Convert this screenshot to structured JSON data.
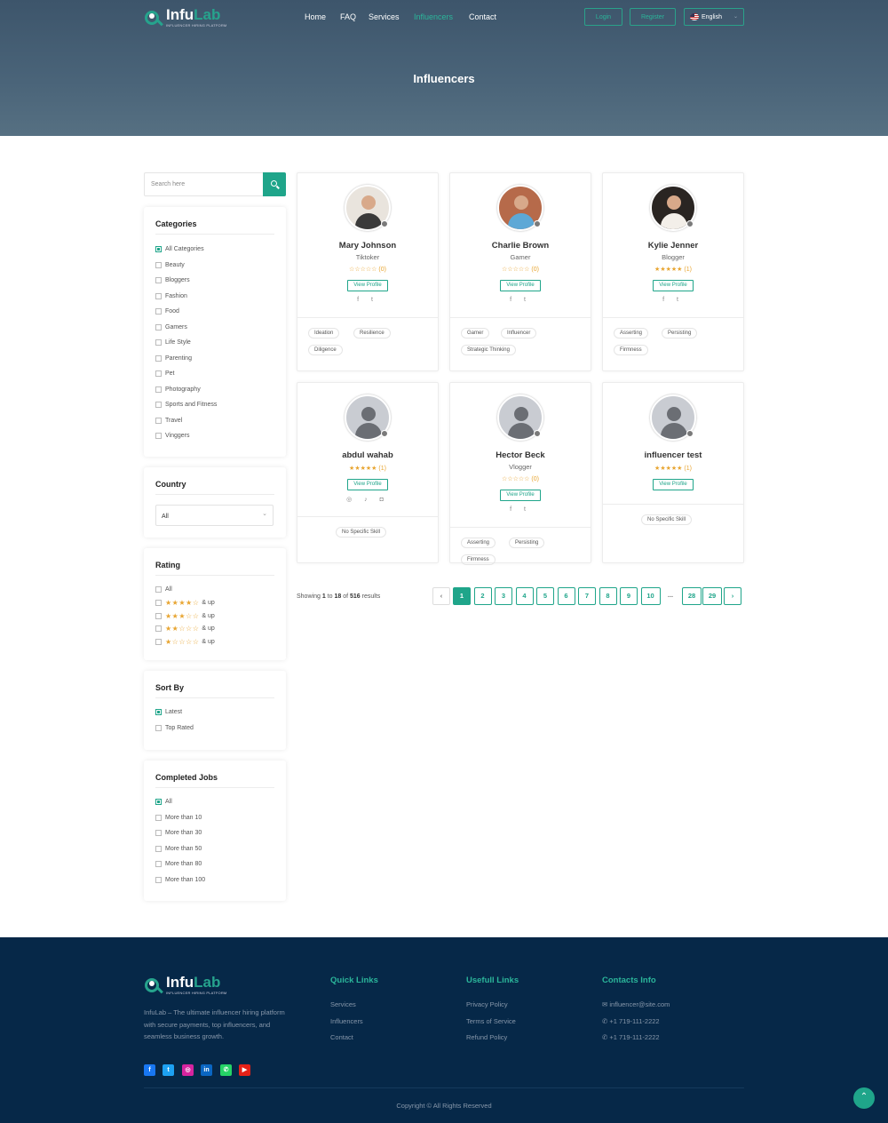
{
  "brand": {
    "name_a": "Infu",
    "name_b": "Lab",
    "tagline": "INFLUENCER HIRING PLATFORM"
  },
  "nav": [
    {
      "label": "Home"
    },
    {
      "label": "FAQ"
    },
    {
      "label": "Services"
    },
    {
      "label": "Influencers"
    },
    {
      "label": "Contact"
    }
  ],
  "header_buttons": {
    "login": "Login",
    "register": "Register",
    "language": "English"
  },
  "page_title": "Influencers",
  "search": {
    "placeholder": "Search here"
  },
  "categories": {
    "title": "Categories",
    "items": [
      "All Categories",
      "Beauty",
      "Bloggers",
      "Fashion",
      "Food",
      "Gamers",
      "Life Style",
      "Parenting",
      "Pet",
      "Photography",
      "Sports and Fitness",
      "Travel",
      "Vinggers"
    ],
    "checked": "All Categories"
  },
  "country": {
    "title": "Country",
    "selected": "All"
  },
  "rating": {
    "title": "Rating",
    "all": "All",
    "up_label": "& up",
    "levels": [
      4,
      3,
      2,
      1
    ]
  },
  "sort": {
    "title": "Sort By",
    "items": [
      "Latest",
      "Top Rated"
    ],
    "checked": "Latest"
  },
  "jobs": {
    "title": "Completed Jobs",
    "items": [
      "All",
      "More than 10",
      "More than 30",
      "More than 50",
      "More than 80",
      "More than 100"
    ],
    "checked": "All"
  },
  "view_profile": "View Profile",
  "influencers": [
    {
      "name": "Mary Johnson",
      "role": "Tiktoker",
      "stars": "☆☆☆☆☆",
      "count": "(0)",
      "socials": "f t",
      "tags": [
        "Ideation",
        "Resilience",
        "Diligence"
      ]
    },
    {
      "name": "Charlie Brown",
      "role": "Gamer",
      "stars": "☆☆☆☆☆",
      "count": "(0)",
      "socials": "f t",
      "tags": [
        "Gamer",
        "Influencer",
        "Strategic Thinking"
      ]
    },
    {
      "name": "Kylie Jenner",
      "role": "Blogger",
      "stars": "★★★★★",
      "count": "(1)",
      "socials": "f t",
      "tags": [
        "Asserting",
        "Persisting",
        "Firmness"
      ]
    },
    {
      "name": "abdul wahab",
      "role": "",
      "stars": "★★★★★",
      "count": "(1)",
      "socials": "◎ ♪ ◘",
      "tags": [
        "No Specific Skill"
      ]
    },
    {
      "name": "Hector Beck",
      "role": "Vlogger",
      "stars": "☆☆☆☆☆",
      "count": "(0)",
      "socials": "f t",
      "tags": [
        "Asserting",
        "Persisting",
        "Firmness"
      ]
    },
    {
      "name": "influencer test",
      "role": "",
      "stars": "★★★★★",
      "count": "(1)",
      "socials": "",
      "tags": [
        "No Specific Skill"
      ]
    }
  ],
  "results": {
    "prefix": "Showing",
    "from": "1",
    "to_word": "to",
    "to": "18",
    "of_word": "of",
    "total": "516",
    "suffix": "results"
  },
  "pagination": {
    "prev": "‹",
    "pages": [
      "1",
      "2",
      "3",
      "4",
      "5",
      "6",
      "7",
      "8",
      "9",
      "10"
    ],
    "ellipsis": "...",
    "tail": [
      "28",
      "29"
    ],
    "next": "›",
    "current": "1"
  },
  "footer": {
    "description": "InfuLab – The ultimate influencer hiring platform with secure payments, top influencers, and seamless business growth.",
    "quick_links": {
      "title": "Quick Links",
      "items": [
        "Services",
        "Influencers",
        "Contact"
      ]
    },
    "useful_links": {
      "title": "Usefull Links",
      "items": [
        "Privacy Policy",
        "Terms of Service",
        "Refund Policy"
      ]
    },
    "contacts": {
      "title": "Contacts Info",
      "items": [
        "influencer@site.com",
        "+1 719-111-2222",
        "+1 719-111-2222"
      ]
    },
    "copyright": "Copyright © All Rights Reserved"
  },
  "colors": {
    "accent": "#1fa58a",
    "header": "#4a6479",
    "footer": "#062848",
    "star": "#e8a531"
  }
}
